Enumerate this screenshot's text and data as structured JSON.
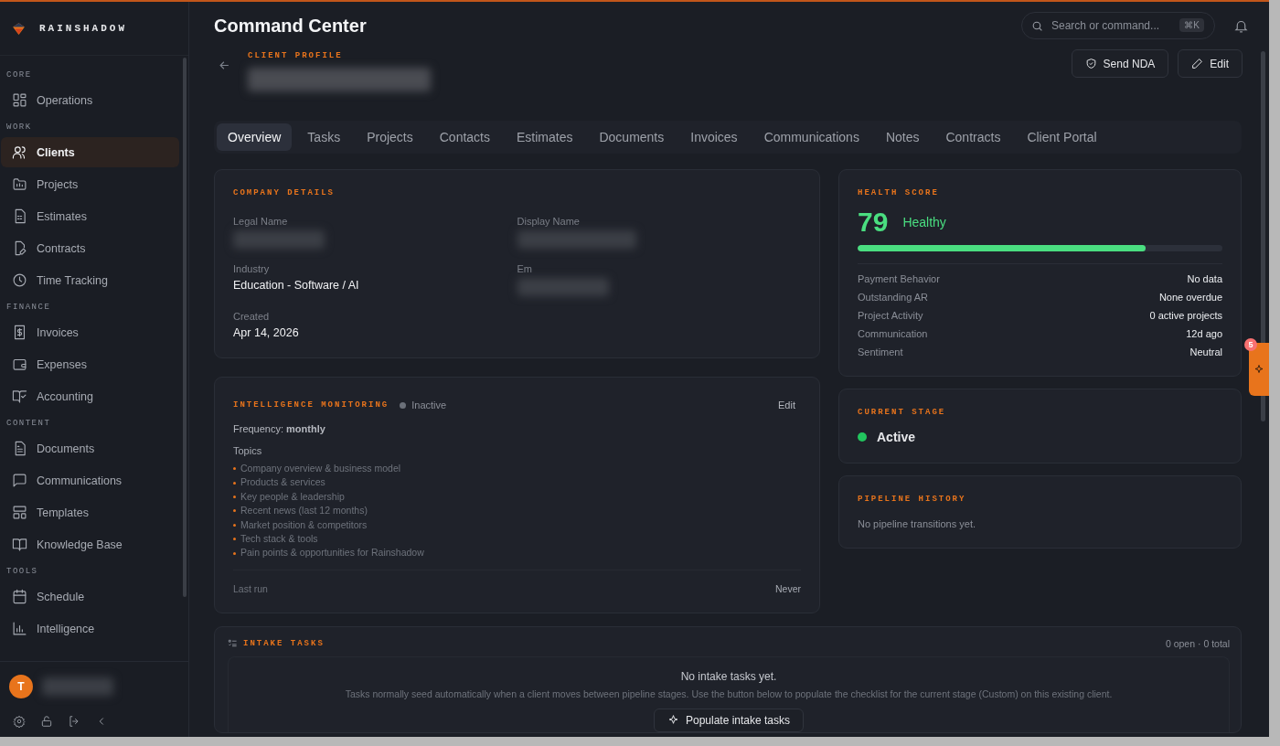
{
  "brand": {
    "name": "RAINSHADOW"
  },
  "sidebar": {
    "sections": [
      {
        "title": "CORE",
        "items": [
          {
            "label": "Operations",
            "selected": false
          }
        ]
      },
      {
        "title": "WORK",
        "items": [
          {
            "label": "Clients",
            "selected": true
          },
          {
            "label": "Projects",
            "selected": false
          },
          {
            "label": "Estimates",
            "selected": false
          },
          {
            "label": "Contracts",
            "selected": false
          },
          {
            "label": "Time Tracking",
            "selected": false
          }
        ]
      },
      {
        "title": "FINANCE",
        "items": [
          {
            "label": "Invoices",
            "selected": false
          },
          {
            "label": "Expenses",
            "selected": false
          },
          {
            "label": "Accounting",
            "selected": false
          }
        ]
      },
      {
        "title": "CONTENT",
        "items": [
          {
            "label": "Documents",
            "selected": false
          },
          {
            "label": "Communications",
            "selected": false
          },
          {
            "label": "Templates",
            "selected": false
          },
          {
            "label": "Knowledge Base",
            "selected": false
          }
        ]
      },
      {
        "title": "TOOLS",
        "items": [
          {
            "label": "Schedule",
            "selected": false
          },
          {
            "label": "Intelligence",
            "selected": false
          }
        ]
      }
    ],
    "user": {
      "initial": "T"
    }
  },
  "header": {
    "title": "Command Center",
    "search": {
      "placeholder": "Search or command...",
      "shortcut": "⌘K"
    }
  },
  "profile": {
    "eyebrow": "CLIENT PROFILE",
    "buttons": [
      "Send NDA",
      "Edit"
    ]
  },
  "tabs": [
    {
      "label": "Overview",
      "selected": true
    },
    {
      "label": "Tasks",
      "selected": false
    },
    {
      "label": "Projects",
      "selected": false
    },
    {
      "label": "Contacts",
      "selected": false
    },
    {
      "label": "Estimates",
      "selected": false
    },
    {
      "label": "Documents",
      "selected": false
    },
    {
      "label": "Invoices",
      "selected": false
    },
    {
      "label": "Communications",
      "selected": false
    },
    {
      "label": "Notes",
      "selected": false
    },
    {
      "label": "Contracts",
      "selected": false
    },
    {
      "label": "Client Portal",
      "selected": false
    }
  ],
  "company_details": {
    "title": "COMPANY DETAILS",
    "fields": [
      {
        "label": "Legal Name",
        "kind": "redacted"
      },
      {
        "label": "Display Name",
        "kind": "redacted"
      },
      {
        "label": "Industry",
        "kind": "text",
        "value": "Education - Software / AI"
      },
      {
        "label": "Em",
        "kind": "redacted"
      },
      {
        "label": "Created",
        "kind": "text",
        "value": "Apr 14, 2026"
      }
    ]
  },
  "intelligence": {
    "title": "INTELLIGENCE MONITORING",
    "status": {
      "label": "Inactive",
      "active": false
    },
    "edit": "Edit",
    "frequency": "Frequency: **monthly**",
    "topics_title": "Topics",
    "topics": [
      "Company overview & business model",
      "Products & services",
      "Key people & leadership",
      "Recent news (last 12 months)",
      "Market position & competitors",
      "Tech stack & tools",
      "Pain points & opportunities for Rainshadow"
    ],
    "last_run": {
      "label": "Last run",
      "value": "Never"
    }
  },
  "health": {
    "title": "HEALTH SCORE",
    "score": "79",
    "status": "Healthy",
    "level": 0.79,
    "metrics": [
      {
        "label": "Payment Behavior",
        "value": "No data"
      },
      {
        "label": "Outstanding AR",
        "value": "None overdue"
      },
      {
        "label": "Project Activity",
        "value": "0 active projects"
      },
      {
        "label": "Communication",
        "value": "12d ago"
      },
      {
        "label": "Sentiment",
        "value": "Neutral"
      }
    ]
  },
  "stage": {
    "title": "CURRENT STAGE",
    "label": "Active",
    "color": "#22c55e"
  },
  "pipeline": {
    "title": "PIPELINE HISTORY",
    "empty": "No pipeline transitions yet."
  },
  "intake": {
    "title": "INTAKE TASKS",
    "count": "0 open · 0 total",
    "empty_title": "No intake tasks yet.",
    "description": "Tasks normally seed automatically when a client moves between pipeline stages. Use the button below to populate the checklist for the current stage (Custom) on this existing client.",
    "button": "Populate intake tasks"
  },
  "assistant": {
    "badge": "5"
  }
}
